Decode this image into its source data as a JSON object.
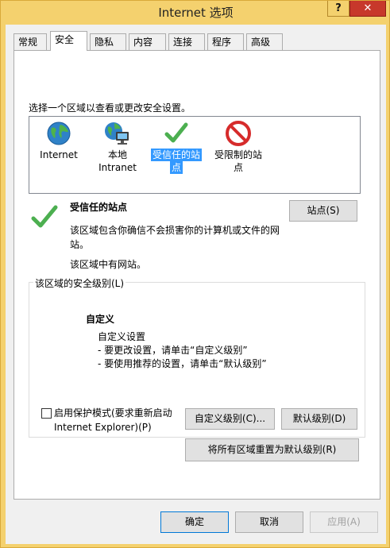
{
  "window": {
    "title": "Internet 选项",
    "help_glyph": "?",
    "close_glyph": "✕"
  },
  "tabs": [
    {
      "label": "常规"
    },
    {
      "label": "安全"
    },
    {
      "label": "隐私"
    },
    {
      "label": "内容"
    },
    {
      "label": "连接"
    },
    {
      "label": "程序"
    },
    {
      "label": "高级"
    }
  ],
  "security": {
    "instruction": "选择一个区域以查看或更改安全设置。",
    "zones": [
      {
        "label_line1": "Internet",
        "label_line2": "",
        "icon": "globe-icon"
      },
      {
        "label_line1": "本地",
        "label_line2": "Intranet",
        "icon": "local-intranet-icon"
      },
      {
        "label_line1": "受信任的站",
        "label_line2": "点",
        "icon": "checkmark-icon"
      },
      {
        "label_line1": "受限制的站",
        "label_line2": "点",
        "icon": "restricted-icon"
      }
    ],
    "selected_zone": {
      "title": "受信任的站点",
      "desc": "该区域包含你确信不会损害你的计算机或文件的网站。",
      "note": "该区域中有网站。"
    },
    "sites_button": "站点(S)",
    "level_legend": "该区域的安全级别(L)",
    "custom_title": "自定义",
    "custom_lines": [
      "自定义设置",
      "- 要更改设置，请单击“自定义级别”",
      "- 要使用推荐的设置，请单击“默认级别”"
    ],
    "protected_mode_line1": "启用保护模式(要求重新启动",
    "protected_mode_line2": "Internet Explorer)(P)",
    "custom_level_button": "自定义级别(C)...",
    "default_level_button": "默认级别(D)",
    "reset_all_button": "将所有区域重置为默认级别(R)"
  },
  "footer": {
    "ok": "确定",
    "cancel": "取消",
    "apply": "应用(A)"
  },
  "colors": {
    "title_bar": "#f4d16e",
    "close_button": "#c7382b",
    "selection": "#3399ff",
    "check_green": "#4caf50"
  }
}
